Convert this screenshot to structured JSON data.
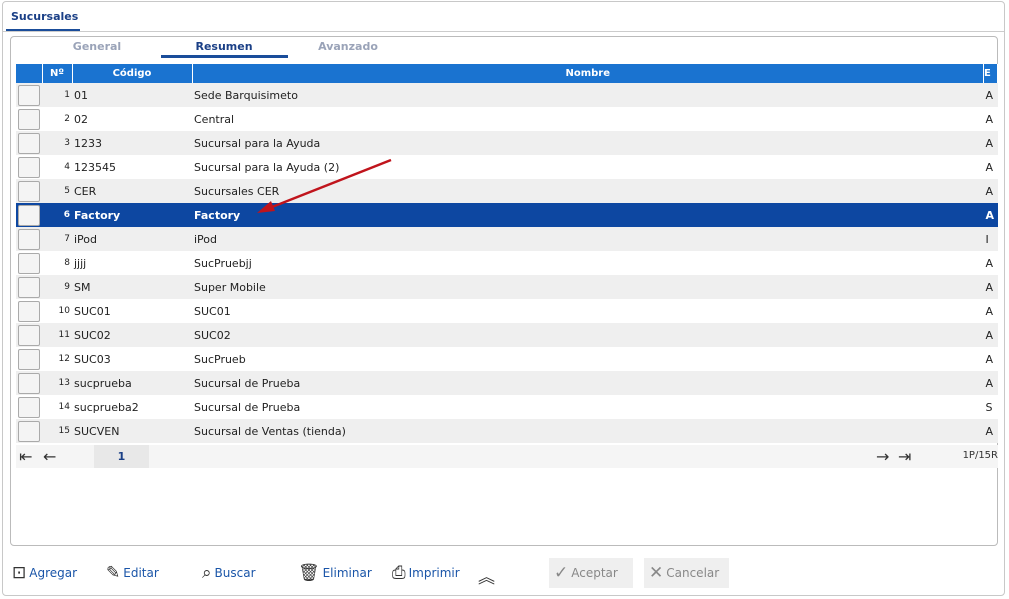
{
  "window": {
    "tab": "Sucursales"
  },
  "subtabs": [
    "General",
    "Resumen",
    "Avanzado"
  ],
  "table": {
    "headers": [
      "Nº",
      "Código",
      "Nombre",
      "E"
    ],
    "rows": [
      [
        "1",
        "01",
        "Sede Barquisimeto",
        "A"
      ],
      [
        "2",
        "02",
        "Central",
        "A"
      ],
      [
        "3",
        "1233",
        "Sucursal para la Ayuda",
        "A"
      ],
      [
        "4",
        "123545",
        "Sucursal para la Ayuda (2)",
        "A"
      ],
      [
        "5",
        "CER",
        "Sucursales CER",
        "A"
      ],
      [
        "6",
        "Factory",
        "Factory",
        "A"
      ],
      [
        "7",
        "iPod",
        "iPod",
        "I"
      ],
      [
        "8",
        "jjjj",
        "SucPruebjj",
        "A"
      ],
      [
        "9",
        "SM",
        "Super Mobile",
        "A"
      ],
      [
        "10",
        "SUC01",
        "SUC01",
        "A"
      ],
      [
        "11",
        "SUC02",
        "SUC02",
        "A"
      ],
      [
        "12",
        "SUC03",
        "SucPrueb",
        "A"
      ],
      [
        "13",
        "sucprueba",
        "Sucursal de Prueba",
        "A"
      ],
      [
        "14",
        "sucprueba2",
        "Sucursal de Prueba",
        "S"
      ],
      [
        "15",
        "SUCVEN",
        "Sucursal de Ventas (tienda)",
        "A"
      ]
    ],
    "selected_index": 5
  },
  "pager": {
    "page": "1",
    "info": "1P/15R"
  },
  "toolbar": {
    "add": "Agregar",
    "edit": "Editar",
    "search": "Buscar",
    "delete": "Eliminar",
    "print": "Imprimir",
    "accept": "Aceptar",
    "cancel": "Cancelar"
  }
}
